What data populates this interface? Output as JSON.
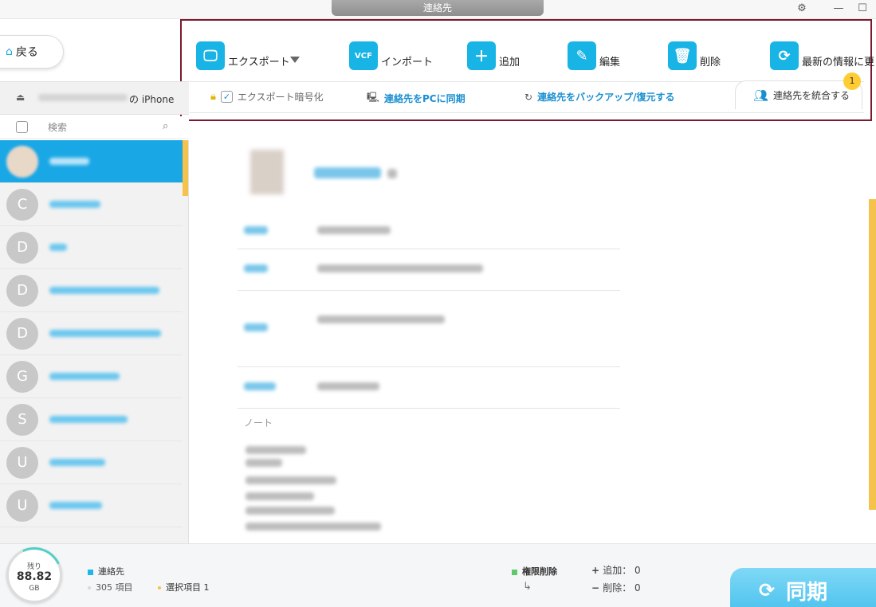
{
  "window": {
    "title": "連絡先",
    "settings_icon": "gear-icon",
    "min": "—",
    "max": "☐"
  },
  "nav": {
    "back_label": "戻る"
  },
  "toolbar": {
    "export": "エクスポート",
    "import": "インポート",
    "import_icon_text": "VCF",
    "add": "追加",
    "edit": "編集",
    "delete": "削除",
    "refresh": "最新の情報に更"
  },
  "subbar": {
    "encrypt_label": "エクスポート暗号化",
    "sync_pc": "連絡先をPCに同期",
    "backup": "連絡先をバックアップ/復元する",
    "merge": "連絡先を統合する",
    "merge_badge": "1"
  },
  "sidebar": {
    "device_suffix": "の iPhone",
    "search_placeholder": "検索",
    "contacts": [
      {
        "initial": ""
      },
      {
        "initial": "C"
      },
      {
        "initial": "D"
      },
      {
        "initial": "D"
      },
      {
        "initial": "D"
      },
      {
        "initial": "G"
      },
      {
        "initial": "S"
      },
      {
        "initial": "U"
      },
      {
        "initial": "U"
      }
    ]
  },
  "detail": {
    "note_label": "ノート"
  },
  "footer": {
    "remaining_label": "残り",
    "storage_value": "88.82",
    "storage_unit": "GB",
    "contacts_label": "連絡先",
    "items_count": "305 項目",
    "selected_items": "選択項目 1",
    "permission_delete": "権限削除",
    "add_stat": "追加： 0",
    "delete_stat": "削除： 0",
    "sync_label": "同期",
    "colors": {
      "contacts": "#1fb7e8",
      "permission": "#5cc96b",
      "selected": "#f5c24b"
    }
  }
}
